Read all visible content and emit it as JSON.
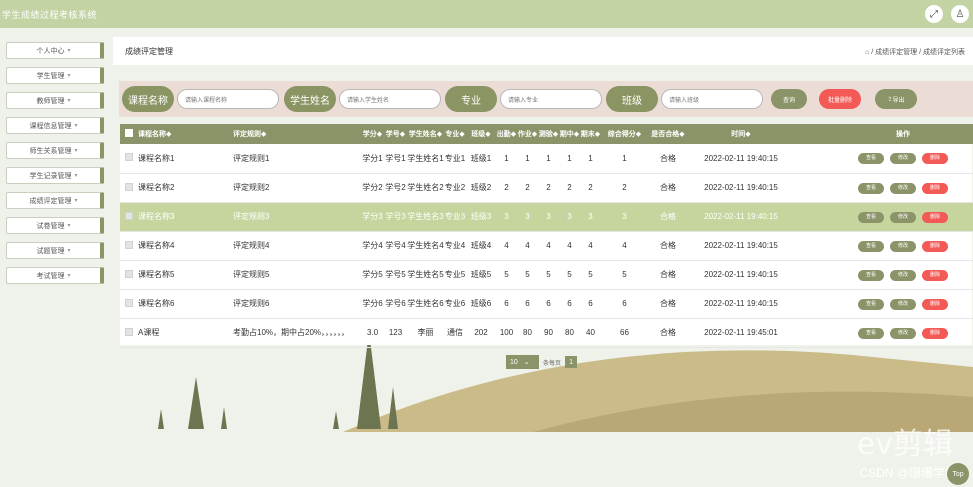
{
  "app": {
    "title": "学生成绩过程考核系统"
  },
  "topbar": {
    "icons": [
      "expand-icon",
      "user-icon"
    ]
  },
  "sidebar": {
    "items": [
      {
        "label": "个人中心"
      },
      {
        "label": "学生管理"
      },
      {
        "label": "教师管理"
      },
      {
        "label": "课程信息管理"
      },
      {
        "label": "师生关系管理"
      },
      {
        "label": "学生记录管理"
      },
      {
        "label": "成绩评定管理"
      },
      {
        "label": "试卷管理"
      },
      {
        "label": "试题管理"
      },
      {
        "label": "考试管理"
      }
    ]
  },
  "page": {
    "title": "成绩评定管理",
    "breadcrumb": "成绩评定管理 / 成绩评定列表"
  },
  "search": {
    "fields": [
      {
        "label": "课程名称",
        "placeholder": "请输入课程名称"
      },
      {
        "label": "学生姓名",
        "placeholder": "请输入学生姓名"
      },
      {
        "label": "专业",
        "placeholder": "请输入专业"
      },
      {
        "label": "班级",
        "placeholder": "请输入班级"
      }
    ],
    "query_label": "查询",
    "batch_delete_label": "批量删除",
    "export_label": "导出"
  },
  "table": {
    "headers": [
      "课程名称◆",
      "评定规则◆",
      "学分◆",
      "学号◆",
      "学生姓名◆",
      "专业◆",
      "班级◆",
      "出勤◆",
      "作业◆",
      "测验◆",
      "期中◆",
      "期末◆",
      "综合得分◆",
      "是否合格◆",
      "时间◆",
      "操作"
    ],
    "rows": [
      {
        "course": "课程名称1",
        "rule": "评定规则1",
        "credit": "学分1",
        "sid": "学号1",
        "name": "学生姓名1",
        "major": "专业1",
        "cls": "班级1",
        "att": "1",
        "hw": "1",
        "quiz": "1",
        "mid": "1",
        "final": "1",
        "total": "1",
        "pass": "合格",
        "time": "2022-02-11 19:40:15"
      },
      {
        "course": "课程名称2",
        "rule": "评定规则2",
        "credit": "学分2",
        "sid": "学号2",
        "name": "学生姓名2",
        "major": "专业2",
        "cls": "班级2",
        "att": "2",
        "hw": "2",
        "quiz": "2",
        "mid": "2",
        "final": "2",
        "total": "2",
        "pass": "合格",
        "time": "2022-02-11 19:40:15"
      },
      {
        "course": "课程名称3",
        "rule": "评定规则3",
        "credit": "学分3",
        "sid": "学号3",
        "name": "学生姓名3",
        "major": "专业3",
        "cls": "班级3",
        "att": "3",
        "hw": "3",
        "quiz": "3",
        "mid": "3",
        "final": "3",
        "total": "3",
        "pass": "合格",
        "time": "2022-02-11 19:40:15"
      },
      {
        "course": "课程名称4",
        "rule": "评定规则4",
        "credit": "学分4",
        "sid": "学号4",
        "name": "学生姓名4",
        "major": "专业4",
        "cls": "班级4",
        "att": "4",
        "hw": "4",
        "quiz": "4",
        "mid": "4",
        "final": "4",
        "total": "4",
        "pass": "合格",
        "time": "2022-02-11 19:40:15"
      },
      {
        "course": "课程名称5",
        "rule": "评定规则5",
        "credit": "学分5",
        "sid": "学号5",
        "name": "学生姓名5",
        "major": "专业5",
        "cls": "班级5",
        "att": "5",
        "hw": "5",
        "quiz": "5",
        "mid": "5",
        "final": "5",
        "total": "5",
        "pass": "合格",
        "time": "2022-02-11 19:40:15"
      },
      {
        "course": "课程名称6",
        "rule": "评定规则6",
        "credit": "学分6",
        "sid": "学号6",
        "name": "学生姓名6",
        "major": "专业6",
        "cls": "班级6",
        "att": "6",
        "hw": "6",
        "quiz": "6",
        "mid": "6",
        "final": "6",
        "total": "6",
        "pass": "合格",
        "time": "2022-02-11 19:40:15"
      },
      {
        "course": "A课程",
        "rule": "考勤占10%，期中占20%，，，，，，",
        "credit": "3.0",
        "sid": "123",
        "name": "李丽",
        "major": "通信",
        "cls": "202",
        "att": "100",
        "hw": "80",
        "quiz": "90",
        "mid": "80",
        "final": "40",
        "total": "66",
        "pass": "合格",
        "time": "2022-02-11 19:45:01"
      }
    ],
    "actions": {
      "view": "查看",
      "edit": "修改",
      "delete": "删除"
    }
  },
  "pager": {
    "page_size": "10",
    "per_page_label": "条每页",
    "current_page": "1"
  },
  "watermark": {
    "brand": "ev剪辑",
    "credit": "CSDN @珊珊学姐",
    "top_label": "Top"
  },
  "colors": {
    "accent": "#8a9468",
    "topbar": "#c3d3a4",
    "danger": "#f45a55",
    "highlight": "#c6d59e"
  }
}
